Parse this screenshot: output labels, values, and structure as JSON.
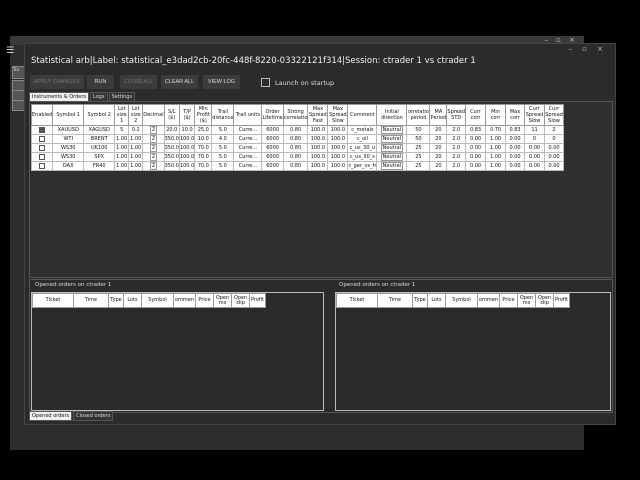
{
  "dialog": {
    "title": "Statistical arb|Label: statistical_e3dad2cb-20fc-448f-8220-03322121f314|Session: ctrader 1 vs ctrader 1",
    "controls": "– ▫ ×"
  },
  "background_window": {
    "controls": "– ▫ ×",
    "menu_icon": "☰",
    "side_labels": [
      "Tra",
      "",
      "",
      ""
    ]
  },
  "toolbar": {
    "apply_label": "APPLY CHANGES",
    "run_label": "RUN",
    "close_all_label": "CLOSE ALL",
    "clear_all_label": "CLEAR ALL",
    "view_log_label": "VIEW LOG",
    "launch_startup_label": "Launch on startup"
  },
  "tabs": [
    "Instruments & Orders",
    "Logs",
    "Settings"
  ],
  "grid": {
    "headers": [
      "Enabled",
      "Symbol 1",
      "Symbol 2",
      "Lot size 1",
      "Lot size 2",
      "Decimals",
      "S/L ($)",
      "T/P ($)",
      "Min Profit ($)",
      "Trail distance",
      "Trail units",
      "Order Lifetime",
      "Strong correlation",
      "Max Spread Fast",
      "Max Spread Slow",
      "Comment",
      "Initial direction",
      "Correlation period",
      "MA Period",
      "Spread STD",
      "Curr corr",
      "Min corr",
      "Max corr",
      "Curr Spread Slow",
      "Curr Spread Slow"
    ],
    "header_display": [
      "Enabled",
      "Symbol 1",
      "Symbol 2",
      "Lot size 1",
      "Lot size 2",
      "Decimal",
      "S/L ($)",
      "T/P ($)",
      "Min Profit ($)",
      "Trail distance",
      "Trail units",
      "Order Lifetime",
      "Strong correlatio",
      "Max Spread Fast",
      "Max Spread Slow",
      "Comment",
      "Initial direction",
      "orrelatio period",
      "MA Period",
      "Spread STD",
      "Curr corr",
      "Min corr",
      "Max corr",
      "Curr Spread Slow",
      "Curr Spread Slow"
    ],
    "rows": [
      {
        "enabled": true,
        "s1": "XAUUSD",
        "s2": "XAGUSD",
        "l1": "5",
        "l2": "0.2",
        "dec": "2",
        "sl": "20.0",
        "tp": "10.0",
        "mp": "25.0",
        "td": "5.0",
        "tu": "Curre...",
        "ol": "6000",
        "sc": "0.80",
        "msf": "100.0",
        "mss": "100.0",
        "cm": "c_metals",
        "dir": "Neutral",
        "cp": "50",
        "ma": "20",
        "std": "2.0",
        "cc": "0.83",
        "mn": "0.70",
        "mx": "0.83",
        "cs1": "11",
        "cs2": "2"
      },
      {
        "enabled": false,
        "s1": "WTI",
        "s2": "BRENT",
        "l1": "1.00",
        "l2": "1.00",
        "dec": "2",
        "sl": "350.0",
        "tp": "100.0",
        "mp": "10.0",
        "td": "4.0",
        "tu": "Curre...",
        "ol": "6000",
        "sc": "0.80",
        "msf": "100.0",
        "mss": "100.0",
        "cm": "c_oil",
        "dir": "Neutral",
        "cp": "50",
        "ma": "20",
        "std": "2.0",
        "cc": "0.00",
        "mn": "1.00",
        "mx": "0.00",
        "cs1": "0",
        "cs2": "0"
      },
      {
        "enabled": false,
        "s1": "WS30",
        "s2": "UK100",
        "l1": "1.00",
        "l2": "1.00",
        "dec": "2",
        "sl": "350.0",
        "tp": "100.0",
        "mp": "70.0",
        "td": "5.0",
        "tu": "Curre...",
        "ol": "6000",
        "sc": "0.80",
        "msf": "100.0",
        "mss": "100.0",
        "cm": "c_us_30_u",
        "dir": "Neutral",
        "cp": "25",
        "ma": "20",
        "std": "2.0",
        "cc": "0.00",
        "mn": "1.00",
        "mx": "0.00",
        "cs1": "0.00",
        "cs2": "0.00"
      },
      {
        "enabled": false,
        "s1": "WS30",
        "s2": "SPX",
        "l1": "1.00",
        "l2": "1.00",
        "dec": "2",
        "sl": "350.0",
        "tp": "100.0",
        "mp": "70.0",
        "td": "5.0",
        "tu": "Curre...",
        "ol": "6000",
        "sc": "0.80",
        "msf": "100.0",
        "mss": "100.0",
        "cm": "c_us_30_s",
        "dir": "Neutral",
        "cp": "25",
        "ma": "20",
        "std": "2.0",
        "cc": "0.00",
        "mn": "1.00",
        "mx": "0.00",
        "cs1": "0.00",
        "cs2": "0.00"
      },
      {
        "enabled": false,
        "s1": "DAX",
        "s2": "FR40",
        "l1": "1.00",
        "l2": "1.00",
        "dec": "2",
        "sl": "350.0",
        "tp": "100.0",
        "mp": "70.0",
        "td": "5.0",
        "tu": "Curre...",
        "ol": "6000",
        "sc": "0.80",
        "msf": "100.0",
        "mss": "100.0",
        "cm": "c_ger_vs_fr",
        "dir": "Neutral",
        "cp": "25",
        "ma": "20",
        "std": "2.0",
        "cc": "0.00",
        "mn": "1.00",
        "mx": "0.00",
        "cs1": "0.00",
        "cs2": "0.00"
      }
    ]
  },
  "orders": {
    "left_title": "Opened orders on  ctrader 1",
    "right_title": "Opened orders on  ctrader 1",
    "headers": [
      "Ticket",
      "Time",
      "Type",
      "Lots",
      "Symbol",
      "Comment",
      "Price",
      "Open ms",
      "Open slip",
      "Profit"
    ],
    "header_display": [
      "Ticket",
      "Time",
      "Type",
      "Lots",
      "Symbol",
      "ommen",
      "Price",
      "Open ms",
      "Open slip",
      "Profit"
    ]
  },
  "bottom_tabs": [
    "Opened orders",
    "Closed orders"
  ]
}
